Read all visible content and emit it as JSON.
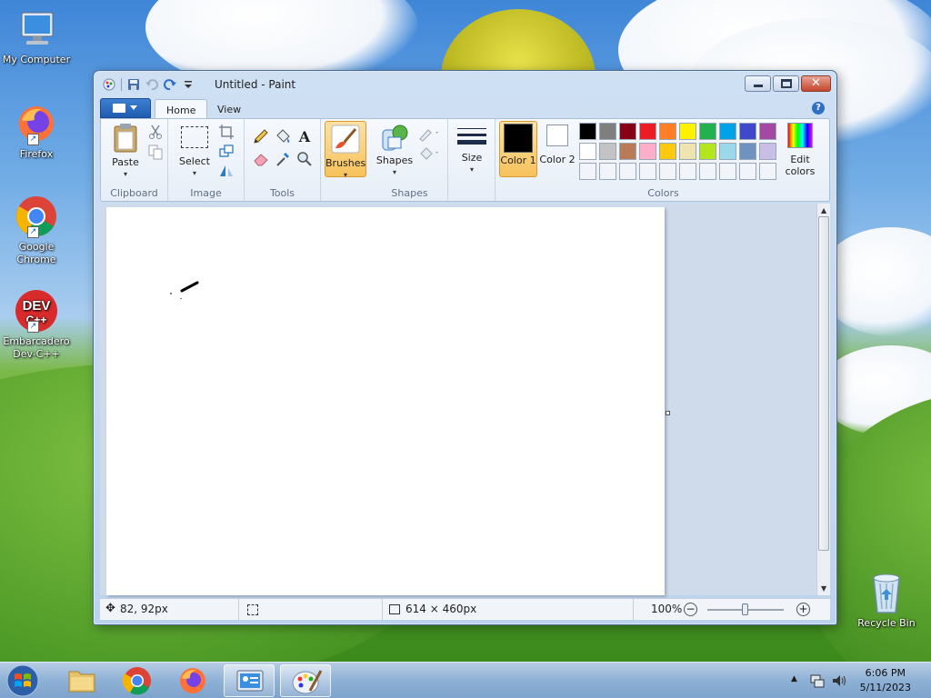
{
  "desktop": {
    "icons": [
      {
        "label": "My Computer",
        "icon": "computer-icon"
      },
      {
        "label": "Firefox",
        "icon": "firefox-icon"
      },
      {
        "label": "Google Chrome",
        "icon": "chrome-icon"
      },
      {
        "label": "Embarcadero Dev-C++",
        "icon": "devcpp-icon"
      },
      {
        "label": "Recycle Bin",
        "icon": "recycle-bin-icon"
      }
    ]
  },
  "window": {
    "title": "Untitled - Paint",
    "tabs": [
      "Home",
      "View"
    ],
    "active_tab": "Home"
  },
  "ribbon": {
    "clipboard": {
      "group": "Clipboard",
      "paste": "Paste"
    },
    "image": {
      "group": "Image",
      "select": "Select"
    },
    "tools": {
      "group": "Tools"
    },
    "brushes": {
      "label": "Brushes"
    },
    "shapes": {
      "group": "Shapes",
      "label": "Shapes"
    },
    "size": {
      "label": "Size"
    },
    "colors": {
      "group": "Colors",
      "color1": "Color 1",
      "color2": "Color 2",
      "edit": "Edit colors",
      "color1_value": "#000000",
      "color2_value": "#ffffff",
      "palette_row1": [
        "#000000",
        "#7f7f7f",
        "#880015",
        "#ed1c24",
        "#ff7f27",
        "#fff200",
        "#22b14c",
        "#00a2e8",
        "#3f48cc",
        "#a349a4"
      ],
      "palette_row2": [
        "#ffffff",
        "#c3c3c3",
        "#b97a57",
        "#ffaec9",
        "#ffc90e",
        "#efe4b0",
        "#b5e61d",
        "#99d9ea",
        "#7092be",
        "#c8bfe7"
      ]
    }
  },
  "status": {
    "cursor": "82, 92px",
    "canvas_size": "614 × 460px",
    "zoom": "100%",
    "zoom_level": 1.0
  },
  "taskbar": {
    "time": "6:06 PM",
    "date": "5/11/2023"
  }
}
